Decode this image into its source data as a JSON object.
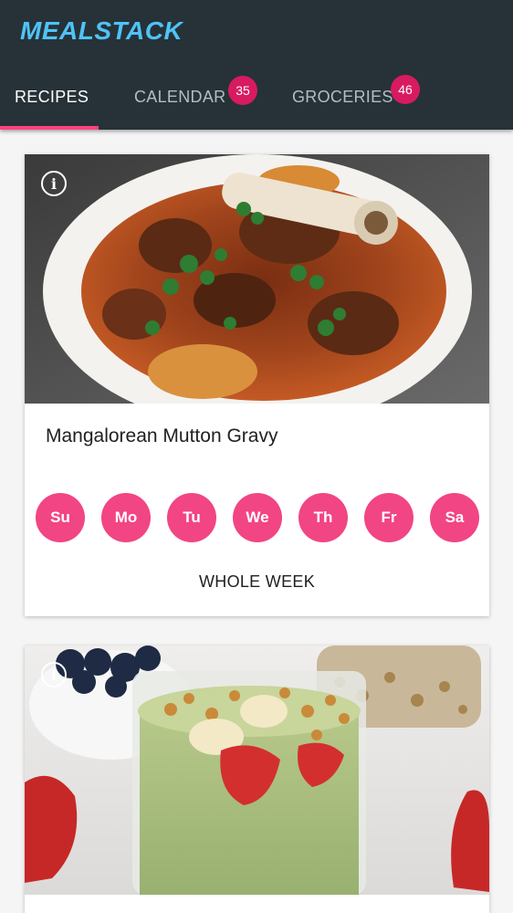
{
  "app": {
    "title": "MEALSTACK"
  },
  "tabs": [
    {
      "label": "RECIPES",
      "active": true
    },
    {
      "label": "CALENDAR",
      "badge": "35"
    },
    {
      "label": "GROCERIES",
      "badge": "46"
    }
  ],
  "cards": [
    {
      "title": "Mangalorean Mutton Gravy",
      "days": [
        "Su",
        "Mo",
        "Tu",
        "We",
        "Th",
        "Fr",
        "Sa"
      ],
      "whole_week_label": "WHOLE WEEK",
      "info_icon": "info-icon"
    },
    {
      "info_icon": "info-icon"
    }
  ],
  "colors": {
    "appbar": "#263238",
    "title": "#4fc3f7",
    "tab_indicator": "#ff4081",
    "badge": "#d81b60",
    "day_button": "#f24583"
  }
}
